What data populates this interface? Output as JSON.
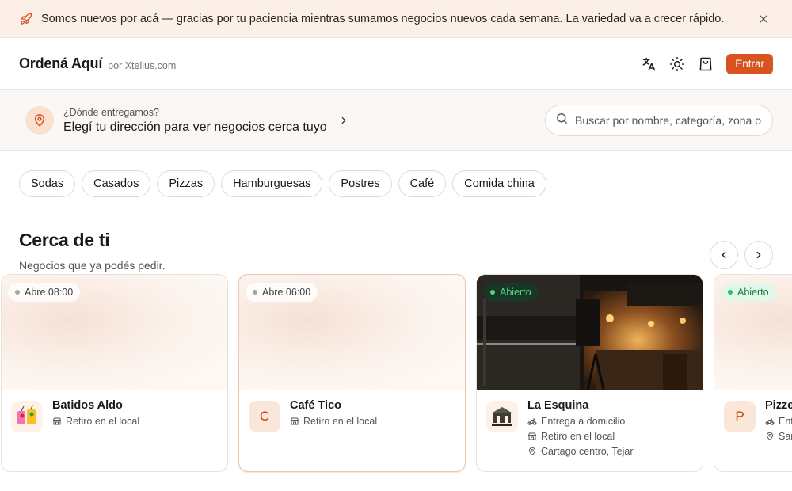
{
  "banner": {
    "message": "Somos nuevos por acá — gracias por tu paciencia mientras sumamos negocios nuevos cada semana. La variedad va a crecer rápido."
  },
  "header": {
    "brand": "Ordená Aquí",
    "by": "por Xtelius.com",
    "enter_label": "Entrar"
  },
  "address": {
    "question": "¿Dónde entregamos?",
    "prompt": "Elegí tu dirección para ver negocios cerca tuyo"
  },
  "search": {
    "placeholder": "Buscar por nombre, categoría, zona o"
  },
  "chips": [
    "Sodas",
    "Casados",
    "Pizzas",
    "Hamburguesas",
    "Postres",
    "Café",
    "Comida china"
  ],
  "section": {
    "title": "Cerca de ti",
    "subtitle": "Negocios que ya podés pedir."
  },
  "cards": [
    {
      "status": "Abre 08:00",
      "name": "Batidos Aldo",
      "avatar": "",
      "meta": [
        {
          "icon": "store-icon",
          "text": "Retiro en el local"
        }
      ]
    },
    {
      "status": "Abre 06:00",
      "name": "Café Tico",
      "avatar": "C",
      "meta": [
        {
          "icon": "store-icon",
          "text": "Retiro en el local"
        }
      ]
    },
    {
      "status": "Abierto",
      "name": "La Esquina",
      "avatar": "",
      "meta": [
        {
          "icon": "bike-icon",
          "text": "Entrega a domicilio"
        },
        {
          "icon": "store-icon",
          "text": "Retiro en el local"
        },
        {
          "icon": "pin-icon",
          "text": "Cartago centro, Tejar"
        }
      ]
    },
    {
      "status": "Abierto",
      "name": "Pizzer",
      "avatar": "P",
      "meta": [
        {
          "icon": "bike-icon",
          "text": "Ent"
        },
        {
          "icon": "pin-icon",
          "text": "San"
        }
      ]
    }
  ],
  "colors": {
    "accent": "#d9531e",
    "banner_bg": "#fcefe8",
    "open_green": "#15803d"
  }
}
